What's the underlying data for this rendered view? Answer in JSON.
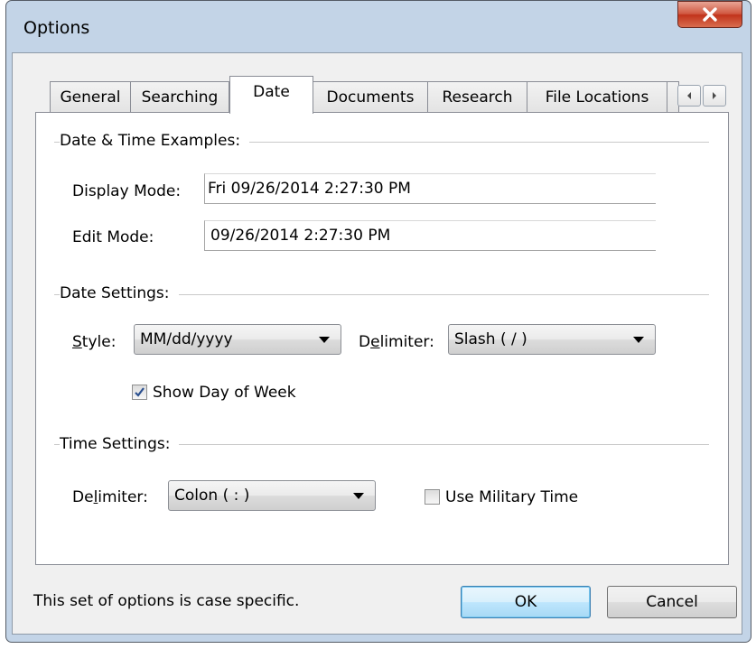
{
  "window": {
    "title": "Options",
    "close_label": "X"
  },
  "tabs": [
    {
      "label": "General",
      "active": false
    },
    {
      "label": "Searching",
      "active": false
    },
    {
      "label": "Date",
      "active": true
    },
    {
      "label": "Documents",
      "active": false
    },
    {
      "label": "Research",
      "active": false
    },
    {
      "label": "File Locations",
      "active": false
    }
  ],
  "examples": {
    "group_label": "Date & Time Examples:",
    "display_mode_label": "Display Mode:",
    "display_mode_value": "Fri 09/26/2014 2:27:30 PM",
    "edit_mode_label": "Edit Mode:",
    "edit_mode_value": "09/26/2014 2:27:30 PM"
  },
  "date_settings": {
    "group_label": "Date Settings:",
    "style_label_accel": "S",
    "style_label_rest": "tyle:",
    "style_value": "MM/dd/yyyy",
    "delimiter_label_pre": "D",
    "delimiter_label_accel": "e",
    "delimiter_label_rest": "limiter:",
    "delimiter_value": "Slash ( / )",
    "show_day_label": "Show Day of Week",
    "show_day_checked": true
  },
  "time_settings": {
    "group_label": "Time Settings:",
    "delimiter_label_pre": "De",
    "delimiter_label_accel": "l",
    "delimiter_label_rest": "imiter:",
    "delimiter_value": "Colon ( : )",
    "military_label": "Use Military Time",
    "military_checked": false
  },
  "footer": {
    "note": "This set of options is case specific.",
    "ok_label": "OK",
    "cancel_label": "Cancel"
  }
}
